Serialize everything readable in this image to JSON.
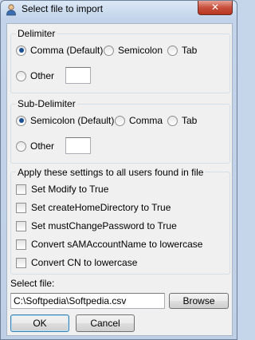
{
  "window": {
    "title": "Select file to import",
    "close_glyph": "✕",
    "icon": "user-icon"
  },
  "delimiter": {
    "label": "Delimiter",
    "options": [
      {
        "label": "Comma (Default)",
        "selected": true
      },
      {
        "label": "Semicolon",
        "selected": false
      },
      {
        "label": "Tab",
        "selected": false
      },
      {
        "label": "Other",
        "selected": false
      }
    ],
    "other_value": ""
  },
  "sub_delimiter": {
    "label": "Sub-Delimiter",
    "options": [
      {
        "label": "Semicolon (Default)",
        "selected": true
      },
      {
        "label": "Comma",
        "selected": false
      },
      {
        "label": "Tab",
        "selected": false
      },
      {
        "label": "Other",
        "selected": false
      }
    ],
    "other_value": ""
  },
  "apply": {
    "label": "Apply these settings to all users found in file",
    "options": [
      {
        "label": "Set Modify to True",
        "checked": false
      },
      {
        "label": "Set createHomeDirectory to True",
        "checked": false
      },
      {
        "label": "Set mustChangePassword to True",
        "checked": false
      },
      {
        "label": "Convert sAMAccountName to lowercase",
        "checked": false
      },
      {
        "label": "Convert CN to lowercase",
        "checked": false
      }
    ]
  },
  "file": {
    "label": "Select file:",
    "path": "C:\\Softpedia\\Softpedia.csv",
    "browse_label": "Browse"
  },
  "buttons": {
    "ok_label": "OK",
    "cancel_label": "Cancel"
  }
}
